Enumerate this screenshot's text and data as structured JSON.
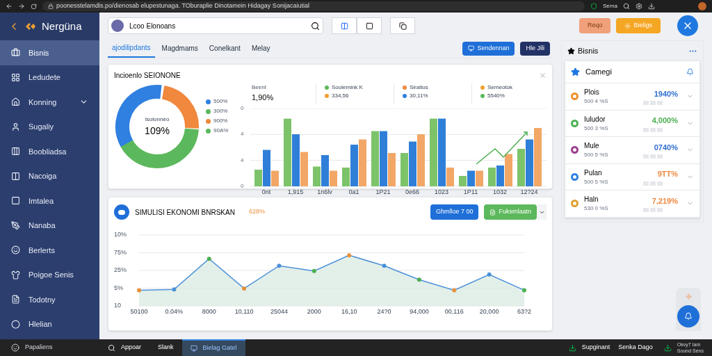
{
  "browser": {
    "url": "poonesstelamdis.po/dienosab elupestunaga. TOburaplie Dinotamein Hidagay Sonijacaiutial",
    "profile": "Sema"
  },
  "sidebar": {
    "brand": "Nergüna",
    "items": [
      {
        "label": "Bisnis",
        "selected": true,
        "kind": "plain"
      },
      {
        "label": "Ledudete",
        "selected": false,
        "kind": "plain"
      },
      {
        "label": "Konning",
        "selected": false,
        "kind": "expandable"
      },
      {
        "label": "Sugaliy",
        "selected": false,
        "kind": "plain"
      },
      {
        "label": "Boobliadsa",
        "selected": false,
        "kind": "plain"
      },
      {
        "label": "Nacoiga",
        "selected": false,
        "kind": "plain"
      },
      {
        "label": "Imtalea",
        "selected": false,
        "kind": "plain"
      },
      {
        "label": "Nanaba",
        "selected": false,
        "kind": "plain"
      },
      {
        "label": "Berlerts",
        "selected": false,
        "kind": "plain"
      },
      {
        "label": "Poigoe Senis",
        "selected": false,
        "kind": "plain"
      },
      {
        "label": "Todotny",
        "selected": false,
        "kind": "plain"
      },
      {
        "label": "Hlelian",
        "selected": false,
        "kind": "plain"
      }
    ]
  },
  "search": {
    "value": "Lcoo Elonoans"
  },
  "header_buttons": [
    "Reqo",
    "Bieligs"
  ],
  "tabs": [
    {
      "label": "ajodilipdants",
      "selected": true
    },
    {
      "label": "Magdmams",
      "selected": false
    },
    {
      "label": "Conelkant",
      "selected": false
    },
    {
      "label": "Melay",
      "selected": false
    }
  ],
  "tab_buttons": [
    "Sendennan",
    "Hle Jili"
  ],
  "overview_card": {
    "title": "Incioenlo SEIONONE",
    "donut": {
      "center_label": "Isolonneo",
      "center_value": "109%",
      "legend": [
        {
          "text": "500%",
          "color": "#2f80e0"
        },
        {
          "text": "300%",
          "color": "#5cb85c"
        },
        {
          "text": "900%",
          "color": "#f0883e"
        },
        {
          "text": "90A%",
          "color": "#5cb85c"
        }
      ]
    },
    "summary": {
      "label": "Beent",
      "value": "1,90%"
    },
    "legend": [
      {
        "text": "Soolemink K",
        "color": "#5cb85c"
      },
      {
        "text": "Siratius",
        "color": "#f0883e"
      },
      {
        "text": "Semeotok",
        "color": "#f0a030"
      },
      {
        "text": "334,56",
        "color": "#f0a030"
      },
      {
        "text": "30,11%",
        "color": "#2f80e0"
      },
      {
        "text": "5540%",
        "color": "#5cb85c"
      }
    ],
    "y_axis_labels": [
      "0",
      "4",
      "4",
      "0"
    ],
    "x_axis_labels": [
      "0nt",
      "1,915",
      "1n6lv",
      "0a1",
      "1P21",
      "0e66",
      "1023",
      "1P11",
      "1032",
      "12?24"
    ]
  },
  "simulation_card": {
    "title": "SIMULISI EKONOMI BNRSKAN",
    "badge": "628%",
    "buttons": [
      "Ghmlloe 7 00",
      "Fuksmlaatn"
    ],
    "y_axis_labels": [
      "10%",
      "75%",
      "25%",
      "5%",
      "10"
    ],
    "x_axis_labels": [
      "50100",
      "0.04%",
      "8000",
      "10,110",
      "25044",
      "2000",
      "16,10",
      "24?0",
      "94,000",
      "00,116",
      "20,000",
      "63?2"
    ]
  },
  "side_panel": {
    "title": "Bisnis",
    "card_title": "Camegi",
    "rows": [
      {
        "name": "Plois",
        "sub": "500 4 %S",
        "value": {
          "text": "1940%",
          "color": "#2f6fd0"
        },
        "color": "#f0902a"
      },
      {
        "name": "Iuludor",
        "sub": "500 3 %S",
        "value": {
          "text": "4,000%",
          "color": "#4caf50"
        },
        "color": "#4caf50"
      },
      {
        "name": "Mule",
        "sub": "500 5 %S",
        "value": {
          "text": "0740%",
          "color": "#2f6fd0"
        },
        "color": "#9c3d8c"
      },
      {
        "name": "Pulan",
        "sub": "500 5 %S",
        "value": {
          "text": "9TT%",
          "color": "#f0883e"
        },
        "color": "#2f80e0"
      },
      {
        "name": "Haln",
        "sub": "530 0 %S",
        "value": {
          "text": "7,219%",
          "color": "#f0883e"
        },
        "color": "#e0a030"
      }
    ]
  },
  "taskbar": {
    "start": "Papaliens",
    "apps": [
      {
        "label": "Appoar",
        "selected": false
      },
      {
        "label": "Slank",
        "selected": false
      },
      {
        "label": "Bielag Gatel",
        "selected": true
      }
    ],
    "tray": [
      "Supginant",
      "Senka Dago"
    ],
    "tray_note": [
      "Okvy7 Iam",
      "Sound Sens"
    ]
  }
}
